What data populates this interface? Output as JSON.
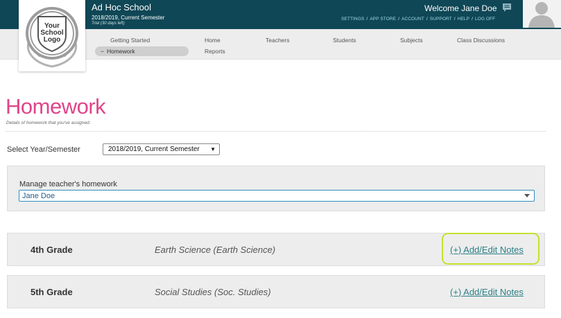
{
  "header": {
    "school_name": "Ad Hoc School",
    "semester": "2018/2019, Current Semester",
    "trial": "Trial (30 days left)",
    "welcome": "Welcome Jane Doe",
    "links": [
      "SETTINGS",
      "APP STORE",
      "ACCOUNT",
      "SUPPORT",
      "HELP",
      "LOG OFF"
    ],
    "colors": {
      "bar": "#0f4756",
      "link": "#9fdde6"
    }
  },
  "logo": {
    "line1": "Your",
    "line2": "School",
    "line3": "Logo"
  },
  "nav": {
    "getting_started": "Getting Started",
    "homework": "Homework",
    "home": "Home",
    "reports": "Reports",
    "teachers": "Teachers",
    "students": "Students",
    "subjects": "Subjects",
    "class_discussions": "Class Discussions"
  },
  "page": {
    "title": "Homework",
    "subtitle": "Details of homework that you've assigned.",
    "title_color": "#e0458a"
  },
  "year_filter": {
    "label": "Select Year/Semester",
    "selected": "2018/2019, Current Semester"
  },
  "manage": {
    "label": "Manage teacher's homework",
    "selected_teacher": "Jane Doe"
  },
  "grades": [
    {
      "grade": "4th Grade",
      "subject": "Earth Science (Earth Science)",
      "link": "(+) Add/Edit Notes"
    },
    {
      "grade": "5th Grade",
      "subject": "Social Studies (Soc. Studies)",
      "link": "(+) Add/Edit Notes"
    }
  ],
  "highlight_color": "#c6e02d"
}
